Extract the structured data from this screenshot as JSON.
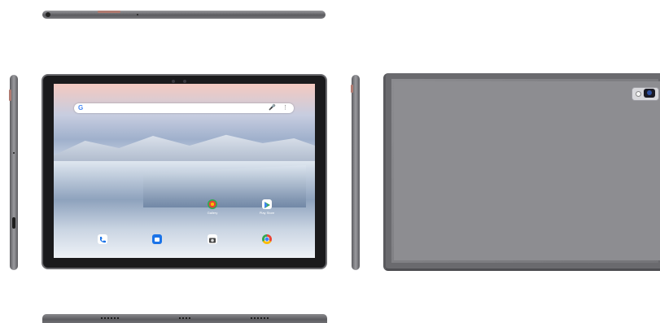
{
  "screen": {
    "status_left": "",
    "status_right": "",
    "search_placeholder": "",
    "apps": [
      {
        "name": "gallery",
        "label": "Gallery",
        "color": "#ffffff"
      },
      {
        "name": "play-store",
        "label": "Play Store",
        "color": "#ffffff"
      },
      {
        "name": "phone",
        "label": "",
        "color": "#1a73e8"
      },
      {
        "name": "messages",
        "label": "",
        "color": "#1a73e8"
      },
      {
        "name": "camera",
        "label": "",
        "color": "#ffffff"
      },
      {
        "name": "chrome",
        "label": "",
        "color": "#ffffff"
      }
    ]
  },
  "colors": {
    "body_gray": "#7e7e82",
    "accent_button": "#b07a70",
    "bezel": "#1a1a1c"
  }
}
